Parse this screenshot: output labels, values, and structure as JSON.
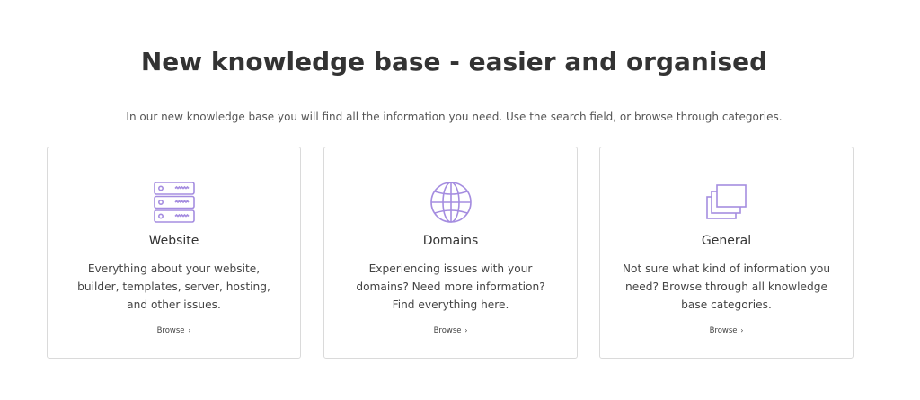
{
  "header": {
    "title": "New knowledge base - easier and organised",
    "subtitle": "In our new knowledge base you will find all the information you need. Use the search field, or browse through categories."
  },
  "accent_color": "#a58de0",
  "cards": [
    {
      "icon": "server-icon",
      "title": "Website",
      "description": "Everything about your website, builder, templates, server, hosting, and other issues.",
      "link_label": "Browse",
      "link_chevron": "›"
    },
    {
      "icon": "globe-icon",
      "title": "Domains",
      "description": "Experiencing issues with your domains? Need more information? Find everything here.",
      "link_label": "Browse",
      "link_chevron": "›"
    },
    {
      "icon": "stacked-pages-icon",
      "title": "General",
      "description": "Not sure what kind of information you need? Browse through all knowledge base categories.",
      "link_label": "Browse",
      "link_chevron": "›"
    }
  ]
}
